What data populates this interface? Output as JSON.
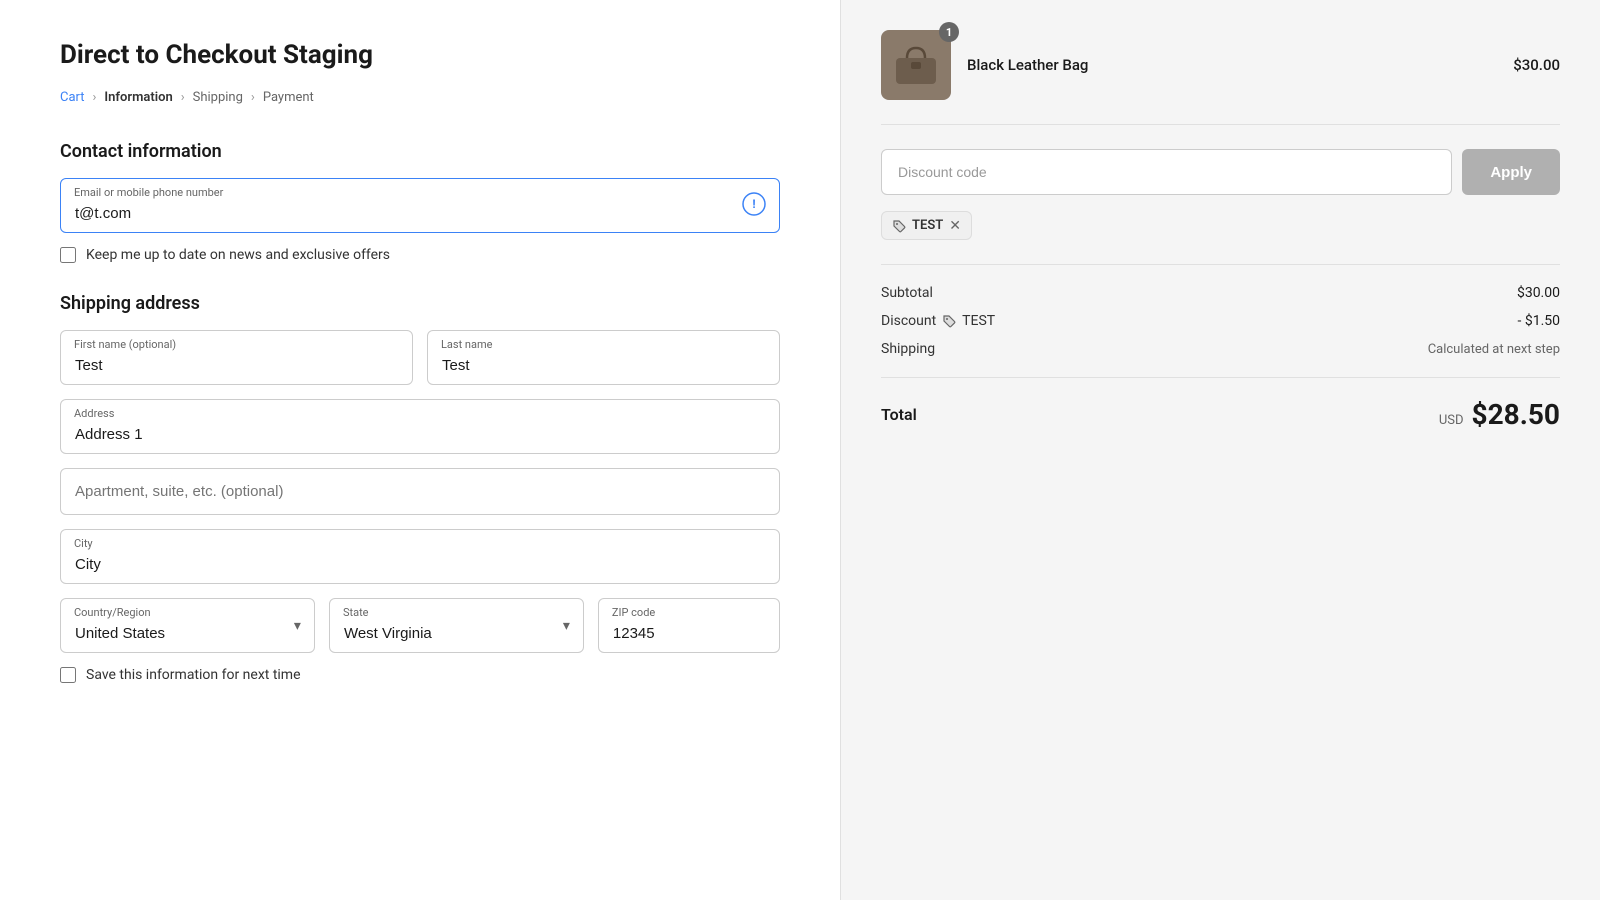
{
  "page": {
    "title": "Direct to Checkout Staging"
  },
  "breadcrumb": {
    "cart": "Cart",
    "information": "Information",
    "shipping": "Shipping",
    "payment": "Payment"
  },
  "contact": {
    "section_title": "Contact information",
    "email_label": "Email or mobile phone number",
    "email_value": "t@t.com",
    "newsletter_label": "Keep me up to date on news and exclusive offers"
  },
  "shipping": {
    "section_title": "Shipping address",
    "first_name_label": "First name (optional)",
    "first_name_value": "Test",
    "last_name_label": "Last name",
    "last_name_value": "Test",
    "address_label": "Address",
    "address_value": "Address 1",
    "apt_placeholder": "Apartment, suite, etc. (optional)",
    "city_label": "City",
    "city_value": "City",
    "country_label": "Country/Region",
    "country_value": "United States",
    "state_label": "State",
    "state_value": "West Virginia",
    "zip_label": "ZIP code",
    "zip_value": "12345",
    "save_label": "Save this information for next time"
  },
  "order": {
    "product_name": "Black Leather Bag",
    "product_price": "$30.00",
    "product_qty": "1",
    "discount_placeholder": "Discount code",
    "apply_label": "Apply",
    "tag_code": "TEST",
    "subtotal_label": "Subtotal",
    "subtotal_value": "$30.00",
    "discount_label": "Discount",
    "discount_code": "TEST",
    "discount_value": "- $1.50",
    "shipping_label": "Shipping",
    "shipping_value": "Calculated at next step",
    "total_label": "Total",
    "total_currency": "USD",
    "total_amount": "$28.50"
  }
}
